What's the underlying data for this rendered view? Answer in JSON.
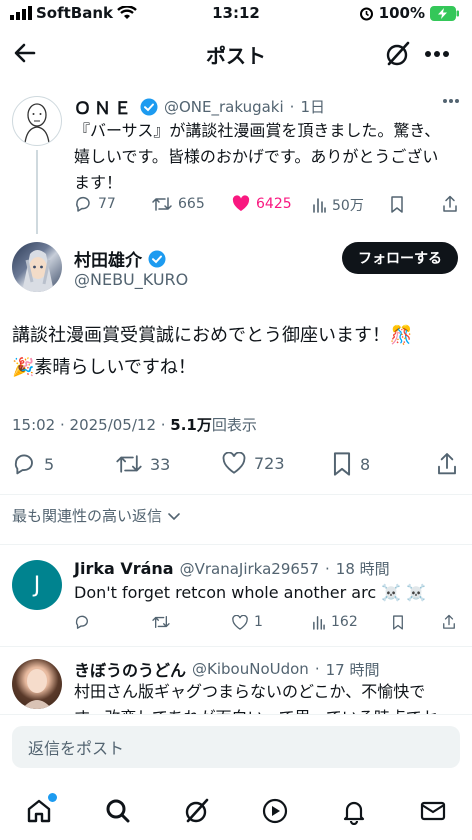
{
  "status_bar": {
    "carrier": "SoftBank",
    "time": "13:12",
    "battery": "100%"
  },
  "header": {
    "title": "ポスト"
  },
  "quoted_tweet": {
    "name": "ＯＮＥ",
    "handle": "@ONE_rakugaki",
    "time": "1日",
    "text_lines": [
      "『バーサス』が講談社漫画賞を頂きました。驚き、",
      "嬉しいです。皆様のおかげです。ありがとうござい",
      "ます！"
    ],
    "replies": "77",
    "retweets": "665",
    "likes": "6425",
    "views": "50万"
  },
  "main_tweet": {
    "name": "村田雄介",
    "handle": "@NEBU_KURO",
    "follow_label": "フォローする",
    "text_lines": [
      "講談社漫画賞受賞誠におめでとう御座います！🎊",
      "🎉素晴らしいですね！"
    ],
    "timestamp": "15:02 · 2025/05/12 · ",
    "views_count": "5.1万",
    "views_label": "回表示",
    "replies": "5",
    "retweets": "33",
    "likes": "723",
    "bookmarks": "8"
  },
  "sort_label": "最も関連性の高い返信",
  "replies": [
    {
      "name": "Jirka Vrána",
      "handle": "@VranaJirka29657",
      "time": "18 時間",
      "avatar_letter": "J",
      "text_lines": [
        "Don't forget retcon whole another arc ☠️ ☠️"
      ],
      "likes": "1",
      "views": "162"
    },
    {
      "name": "きぼうのうどん",
      "handle": "@KibouNoUdon",
      "time": "17 時間",
      "text_lines": [
        "村田さん版ギャグつまらないのどこか、不愉快で",
        "す。改変してあれが面白いって思っている時点でセ"
      ]
    }
  ],
  "reply_bar": {
    "placeholder": "返信をポスト"
  },
  "colors": {
    "verified": "#1d9bf0",
    "like": "#f91880",
    "avatar_j": "#00838f",
    "notification_dot": "#1d9bf0"
  }
}
